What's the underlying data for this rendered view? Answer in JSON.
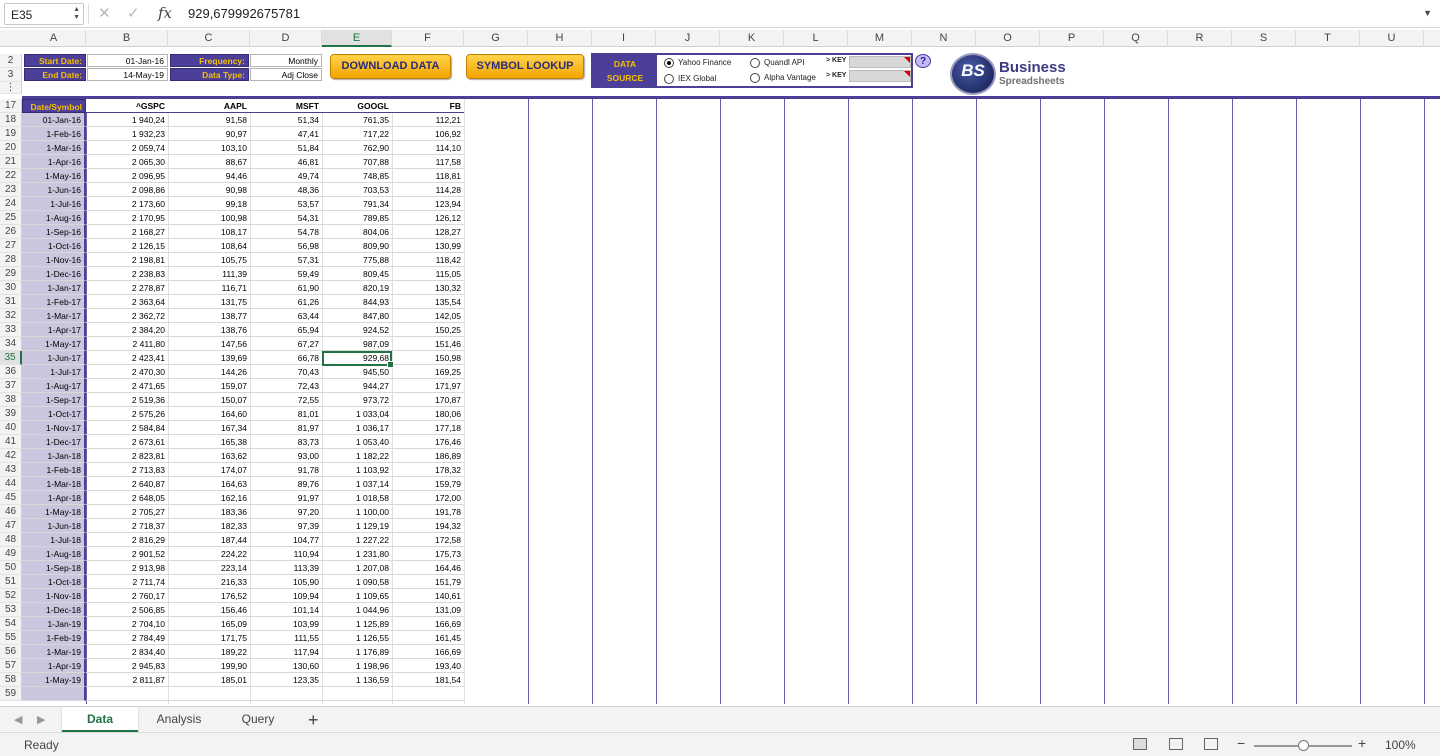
{
  "formula_bar": {
    "name_box": "E35",
    "formula": "929,679992675781",
    "fx": "fx",
    "cancel_icon": "✕",
    "confirm_icon": "✓"
  },
  "columns": [
    "A",
    "B",
    "C",
    "D",
    "E",
    "F",
    "G",
    "H",
    "I",
    "J",
    "K",
    "L",
    "M",
    "N",
    "O",
    "P",
    "Q",
    "R",
    "S",
    "T",
    "U"
  ],
  "selected_column": "E",
  "panel": {
    "start_date_label": "Start Date:",
    "start_date": "01-Jan-16",
    "end_date_label": "End Date:",
    "end_date": "14-May-19",
    "frequency_label": "Frequency:",
    "frequency": "Monthly",
    "data_type_label": "Data Type:",
    "data_type": "Adj Close",
    "download_button": "DOWNLOAD DATA",
    "lookup_button": "SYMBOL LOOKUP",
    "data_source_label_1": "DATA",
    "data_source_label_2": "SOURCE",
    "source_yahoo": "Yahoo Finance",
    "source_iex": "IEX Global",
    "source_quandl": "Quandl API",
    "source_alpha": "Alpha Vantage",
    "key_label_1": "> KEY",
    "key_label_2": "> KEY",
    "selected_source": "Yahoo Finance",
    "help": "?",
    "logo_mark": "BS",
    "logo_text_1": "Business",
    "logo_text_2": "Spreadsheets"
  },
  "top_rows": [
    "2",
    "3",
    "⋮"
  ],
  "table": {
    "headers": [
      "Date/Symbol",
      "^GSPC",
      "AAPL",
      "MSFT",
      "GOOGL",
      "FB"
    ],
    "header_row_num": "17",
    "rows": [
      [
        "18",
        "01-Jan-16",
        "1 940,24",
        "91,58",
        "51,34",
        "761,35",
        "112,21"
      ],
      [
        "19",
        "1-Feb-16",
        "1 932,23",
        "90,97",
        "47,41",
        "717,22",
        "106,92"
      ],
      [
        "20",
        "1-Mar-16",
        "2 059,74",
        "103,10",
        "51,84",
        "762,90",
        "114,10"
      ],
      [
        "21",
        "1-Apr-16",
        "2 065,30",
        "88,67",
        "46,81",
        "707,88",
        "117,58"
      ],
      [
        "22",
        "1-May-16",
        "2 096,95",
        "94,46",
        "49,74",
        "748,85",
        "118,81"
      ],
      [
        "23",
        "1-Jun-16",
        "2 098,86",
        "90,98",
        "48,36",
        "703,53",
        "114,28"
      ],
      [
        "24",
        "1-Jul-16",
        "2 173,60",
        "99,18",
        "53,57",
        "791,34",
        "123,94"
      ],
      [
        "25",
        "1-Aug-16",
        "2 170,95",
        "100,98",
        "54,31",
        "789,85",
        "126,12"
      ],
      [
        "26",
        "1-Sep-16",
        "2 168,27",
        "108,17",
        "54,78",
        "804,06",
        "128,27"
      ],
      [
        "27",
        "1-Oct-16",
        "2 126,15",
        "108,64",
        "56,98",
        "809,90",
        "130,99"
      ],
      [
        "28",
        "1-Nov-16",
        "2 198,81",
        "105,75",
        "57,31",
        "775,88",
        "118,42"
      ],
      [
        "29",
        "1-Dec-16",
        "2 238,83",
        "111,39",
        "59,49",
        "809,45",
        "115,05"
      ],
      [
        "30",
        "1-Jan-17",
        "2 278,87",
        "116,71",
        "61,90",
        "820,19",
        "130,32"
      ],
      [
        "31",
        "1-Feb-17",
        "2 363,64",
        "131,75",
        "61,26",
        "844,93",
        "135,54"
      ],
      [
        "32",
        "1-Mar-17",
        "2 362,72",
        "138,77",
        "63,44",
        "847,80",
        "142,05"
      ],
      [
        "33",
        "1-Apr-17",
        "2 384,20",
        "138,76",
        "65,94",
        "924,52",
        "150,25"
      ],
      [
        "34",
        "1-May-17",
        "2 411,80",
        "147,56",
        "67,27",
        "987,09",
        "151,46"
      ],
      [
        "35",
        "1-Jun-17",
        "2 423,41",
        "139,69",
        "66,78",
        "929,68",
        "150,98"
      ],
      [
        "36",
        "1-Jul-17",
        "2 470,30",
        "144,26",
        "70,43",
        "945,50",
        "169,25"
      ],
      [
        "37",
        "1-Aug-17",
        "2 471,65",
        "159,07",
        "72,43",
        "944,27",
        "171,97"
      ],
      [
        "38",
        "1-Sep-17",
        "2 519,36",
        "150,07",
        "72,55",
        "973,72",
        "170,87"
      ],
      [
        "39",
        "1-Oct-17",
        "2 575,26",
        "164,60",
        "81,01",
        "1 033,04",
        "180,06"
      ],
      [
        "40",
        "1-Nov-17",
        "2 584,84",
        "167,34",
        "81,97",
        "1 036,17",
        "177,18"
      ],
      [
        "41",
        "1-Dec-17",
        "2 673,61",
        "165,38",
        "83,73",
        "1 053,40",
        "176,46"
      ],
      [
        "42",
        "1-Jan-18",
        "2 823,81",
        "163,62",
        "93,00",
        "1 182,22",
        "186,89"
      ],
      [
        "43",
        "1-Feb-18",
        "2 713,83",
        "174,07",
        "91,78",
        "1 103,92",
        "178,32"
      ],
      [
        "44",
        "1-Mar-18",
        "2 640,87",
        "164,63",
        "89,76",
        "1 037,14",
        "159,79"
      ],
      [
        "45",
        "1-Apr-18",
        "2 648,05",
        "162,16",
        "91,97",
        "1 018,58",
        "172,00"
      ],
      [
        "46",
        "1-May-18",
        "2 705,27",
        "183,36",
        "97,20",
        "1 100,00",
        "191,78"
      ],
      [
        "47",
        "1-Jun-18",
        "2 718,37",
        "182,33",
        "97,39",
        "1 129,19",
        "194,32"
      ],
      [
        "48",
        "1-Jul-18",
        "2 816,29",
        "187,44",
        "104,77",
        "1 227,22",
        "172,58"
      ],
      [
        "49",
        "1-Aug-18",
        "2 901,52",
        "224,22",
        "110,94",
        "1 231,80",
        "175,73"
      ],
      [
        "50",
        "1-Sep-18",
        "2 913,98",
        "223,14",
        "113,39",
        "1 207,08",
        "164,46"
      ],
      [
        "51",
        "1-Oct-18",
        "2 711,74",
        "216,33",
        "105,90",
        "1 090,58",
        "151,79"
      ],
      [
        "52",
        "1-Nov-18",
        "2 760,17",
        "176,52",
        "109,94",
        "1 109,65",
        "140,61"
      ],
      [
        "53",
        "1-Dec-18",
        "2 506,85",
        "156,46",
        "101,14",
        "1 044,96",
        "131,09"
      ],
      [
        "54",
        "1-Jan-19",
        "2 704,10",
        "165,09",
        "103,99",
        "1 125,89",
        "166,69"
      ],
      [
        "55",
        "1-Feb-19",
        "2 784,49",
        "171,75",
        "111,55",
        "1 126,55",
        "161,45"
      ],
      [
        "56",
        "1-Mar-19",
        "2 834,40",
        "189,22",
        "117,94",
        "1 176,89",
        "166,69"
      ],
      [
        "57",
        "1-Apr-19",
        "2 945,83",
        "199,90",
        "130,60",
        "1 198,96",
        "193,40"
      ],
      [
        "58",
        "1-May-19",
        "2 811,87",
        "185,01",
        "123,35",
        "1 136,59",
        "181,54"
      ],
      [
        "59",
        "",
        "",
        "",
        "",
        "",
        ""
      ]
    ]
  },
  "sheet_tabs": [
    "Data",
    "Analysis",
    "Query"
  ],
  "active_tab": "Data",
  "add_tab": "+",
  "status": {
    "ready": "Ready",
    "zoom": "100%",
    "zoom_minus": "−",
    "zoom_plus": "+"
  }
}
